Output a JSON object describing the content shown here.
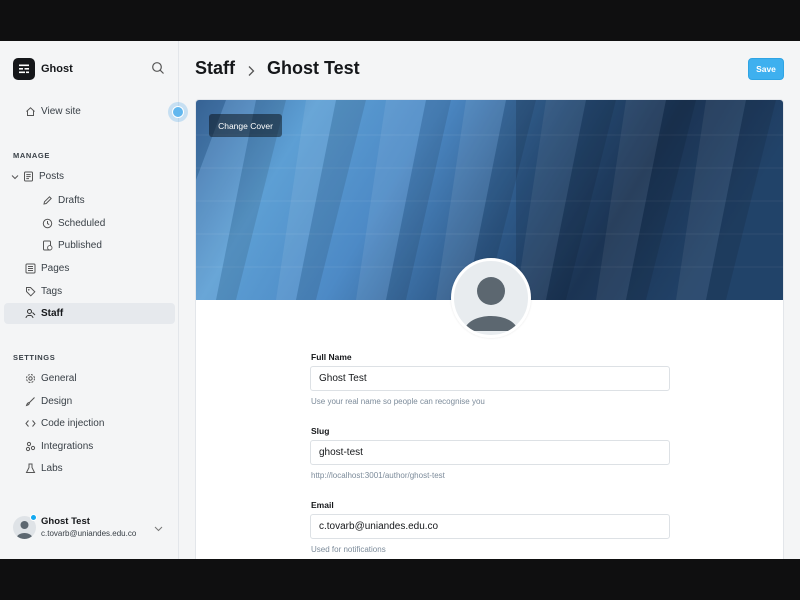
{
  "sidebar": {
    "brand_name": "Ghost",
    "view_site": "View site",
    "manage_label": "MANAGE",
    "posts": "Posts",
    "drafts": "Drafts",
    "scheduled": "Scheduled",
    "published": "Published",
    "pages": "Pages",
    "tags": "Tags",
    "staff": "Staff",
    "settings_label": "SETTINGS",
    "general": "General",
    "design": "Design",
    "code_injection": "Code injection",
    "integrations": "Integrations",
    "labs": "Labs",
    "user_name": "Ghost Test",
    "user_email": "c.tovarb@uniandes.edu.co"
  },
  "header": {
    "crumb_root": "Staff",
    "crumb_current": "Ghost Test",
    "save_label": "Save"
  },
  "profile": {
    "change_cover": "Change Cover",
    "full_name_label": "Full Name",
    "full_name_value": "Ghost Test",
    "full_name_help": "Use your real name so people can recognise you",
    "slug_label": "Slug",
    "slug_value": "ghost-test",
    "slug_help": "http://localhost:3001/author/ghost-test",
    "email_label": "Email",
    "email_value": "c.tovarb@uniandes.edu.co",
    "email_help": "Used for notifications"
  },
  "colors": {
    "accent": "#3eb0ef",
    "sidebar_bg": "#f4f5f6",
    "active_item_bg": "#e6e9ed"
  }
}
